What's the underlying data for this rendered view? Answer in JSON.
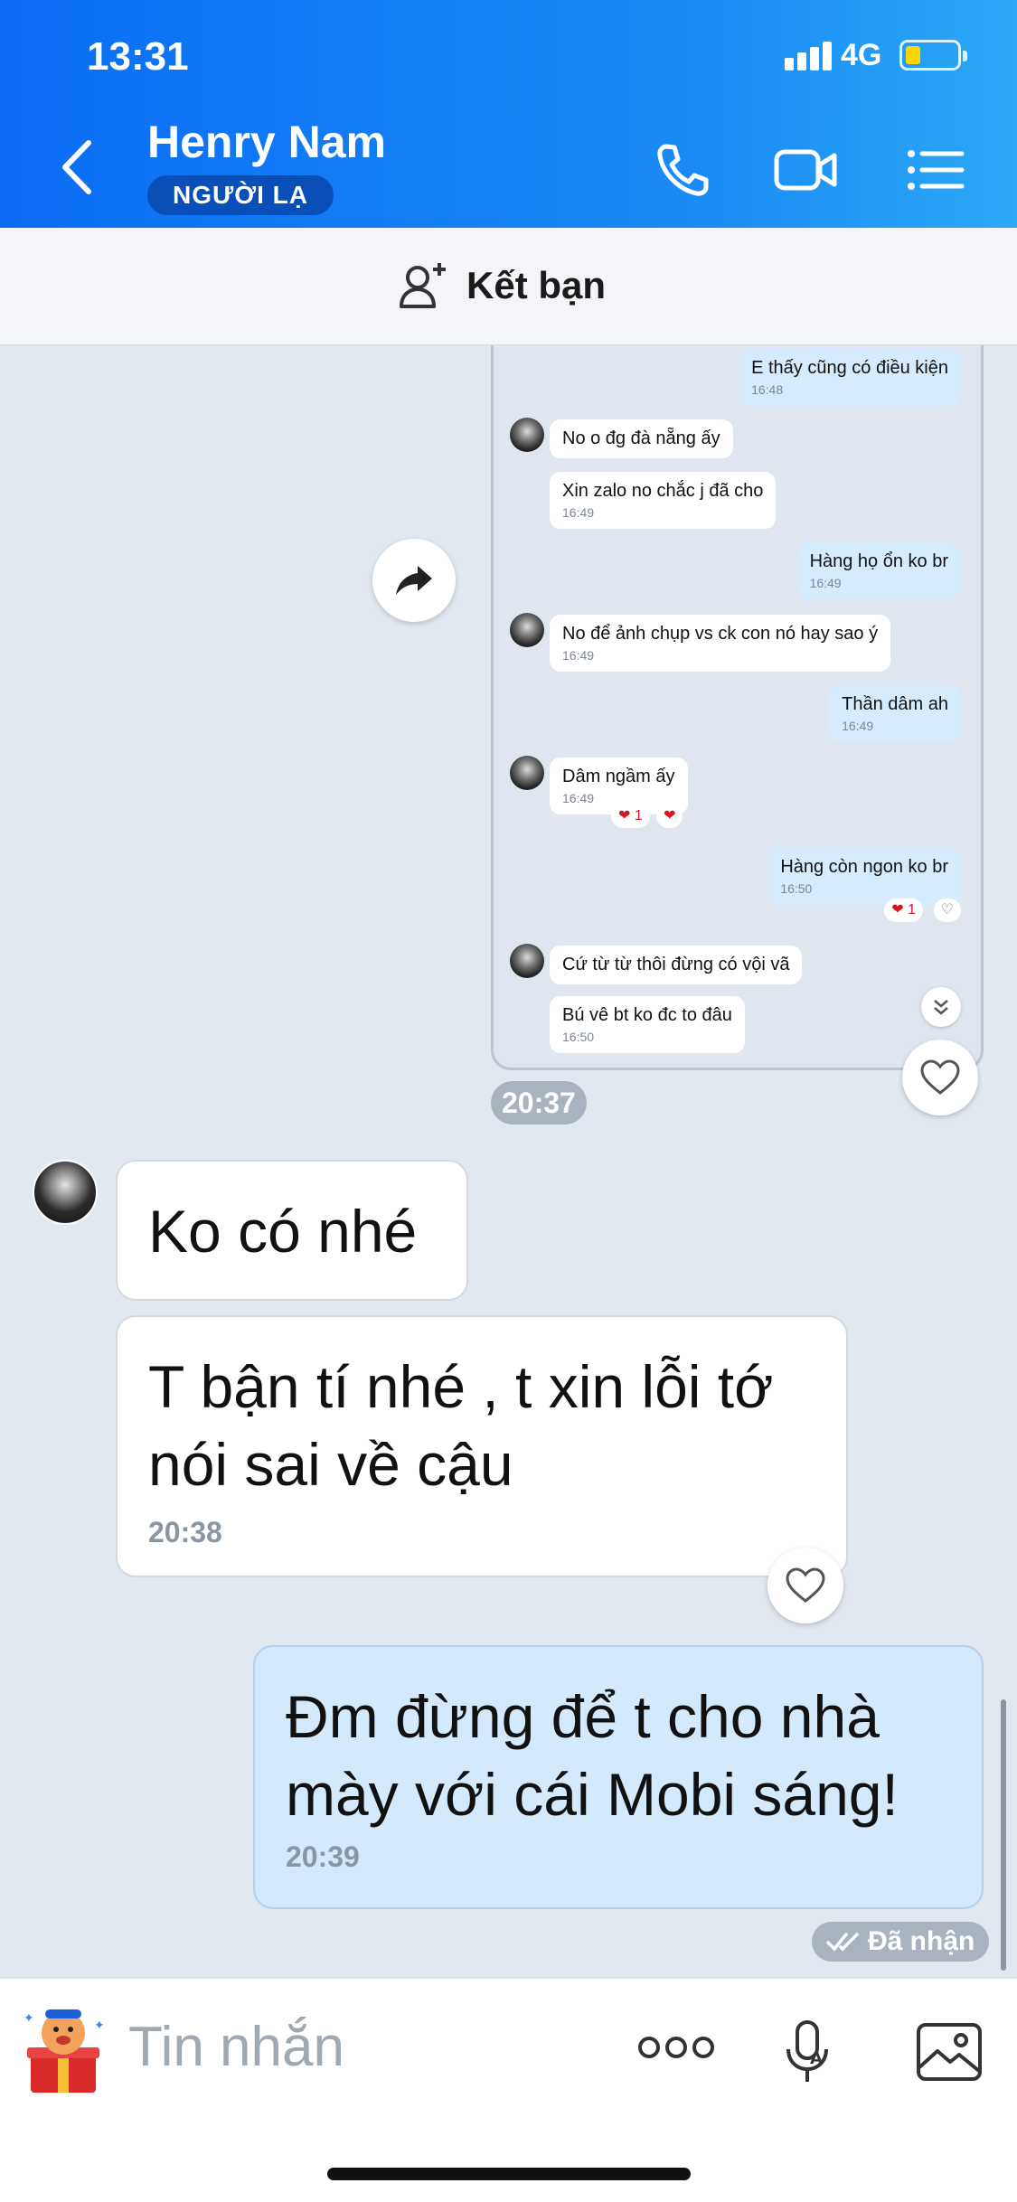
{
  "status_bar": {
    "time": "13:31",
    "network": "4G",
    "battery_color": "#ffd600"
  },
  "header": {
    "contact_name": "Henry Nam",
    "badge": "NGƯỜI LẠ",
    "icons": [
      "back-icon",
      "phone-icon",
      "video-call-icon",
      "menu-list-icon"
    ],
    "gradient": [
      "#0a6cf4",
      "#2aa8f5"
    ]
  },
  "friend_bar": {
    "label": "Kết bạn",
    "icon": "add-friend-icon"
  },
  "embedded_screenshot": {
    "messages": [
      {
        "side": "me",
        "text": "E thấy cũng có điều kiện",
        "time": "16:48"
      },
      {
        "side": "them",
        "text": "No o đg đà nẵng ấy",
        "time": ""
      },
      {
        "side": "them",
        "text": "Xin zalo no chắc j đã cho",
        "time": "16:49"
      },
      {
        "side": "me",
        "text": "Hàng họ ổn ko br",
        "time": "16:49"
      },
      {
        "side": "them",
        "text": "No để ảnh chụp vs ck con nó hay sao ý",
        "time": "16:49"
      },
      {
        "side": "me",
        "text": "Thần dâm ah",
        "time": "16:49"
      },
      {
        "side": "them",
        "text": "Dâm ngầm ấy",
        "time": "16:49"
      },
      {
        "side": "me",
        "text": "Hàng còn ngon ko br",
        "time": "16:50"
      },
      {
        "side": "them",
        "text": "Cứ từ từ thôi đừng có vội vã",
        "time": ""
      },
      {
        "side": "them",
        "text": "Bú vê bt ko đc to đâu",
        "time": "16:50"
      }
    ],
    "reactions": {
      "heart_count": "1"
    }
  },
  "chat": {
    "time_separator": "20:37",
    "messages": [
      {
        "side": "them",
        "text": "Ko có nhé",
        "time": ""
      },
      {
        "side": "them",
        "text": "T bận tí nhé , t xin lỗi tớ nói sai về cậu",
        "time": "20:38"
      },
      {
        "side": "me",
        "text": "Đm đừng để t cho nhà mày với cái Mobi sáng!",
        "time": "20:39"
      }
    ],
    "status": "Đã nhận"
  },
  "input": {
    "placeholder": "Tin nhắn",
    "icons": [
      "sticker-icon",
      "more-icon",
      "voice-icon",
      "image-icon"
    ]
  }
}
